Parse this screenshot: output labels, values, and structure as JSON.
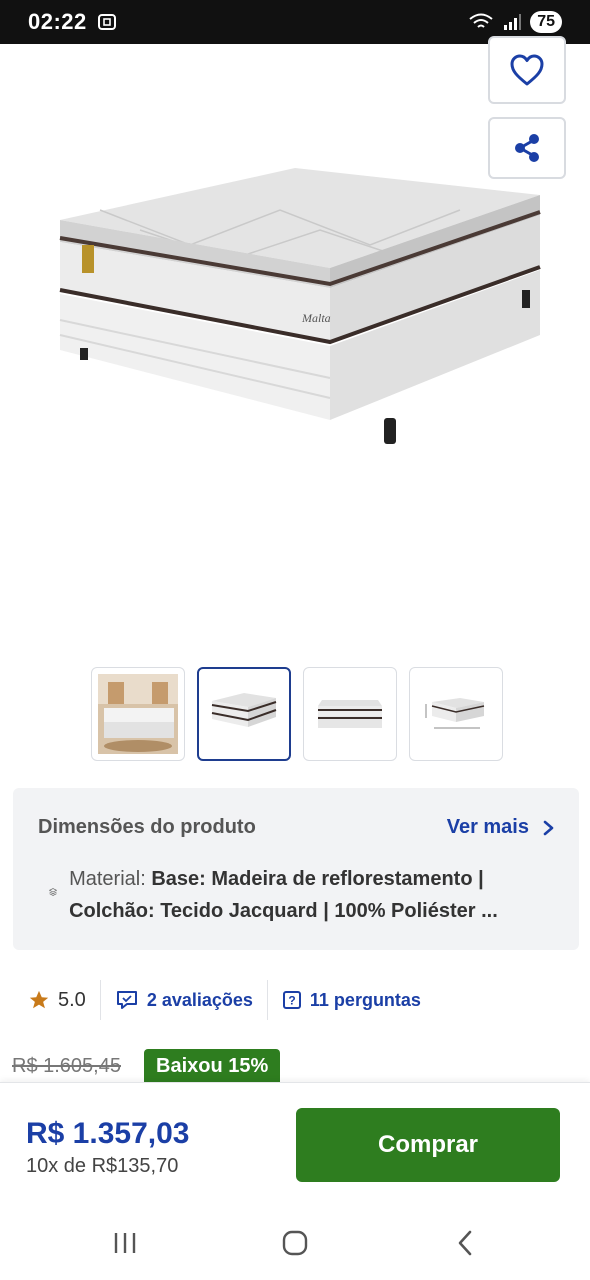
{
  "status": {
    "time": "02:22",
    "battery": "75"
  },
  "actions": {
    "favorite_icon": "heart-icon",
    "share_icon": "share-icon"
  },
  "product": {
    "brand_on_image": "Malta"
  },
  "gallery": {
    "thumbnails": [
      "bedroom-photo",
      "mattress-angle",
      "mattress-front",
      "mattress-dimensions"
    ],
    "active_index": 1
  },
  "dimensions": {
    "title": "Dimensões do produto",
    "more_label": "Ver mais",
    "label": "Material: ",
    "value": "Base: Madeira de reflorestamento | Colchão: Tecido Jacquard | 100% Poliéster ..."
  },
  "rating": {
    "score": "5.0",
    "reviews": "2 avaliações",
    "questions": "11 perguntas"
  },
  "pricing": {
    "old_price": "R$ 1.605,45",
    "discount_badge": "Baixou 15%",
    "price": "R$ 1.357,03",
    "installments": "10x de R$135,70"
  },
  "buy": {
    "label": "Comprar"
  },
  "colors": {
    "brand_blue": "#1b3fa6",
    "buy_green": "#2e7d1f",
    "star": "#c87a1a"
  }
}
